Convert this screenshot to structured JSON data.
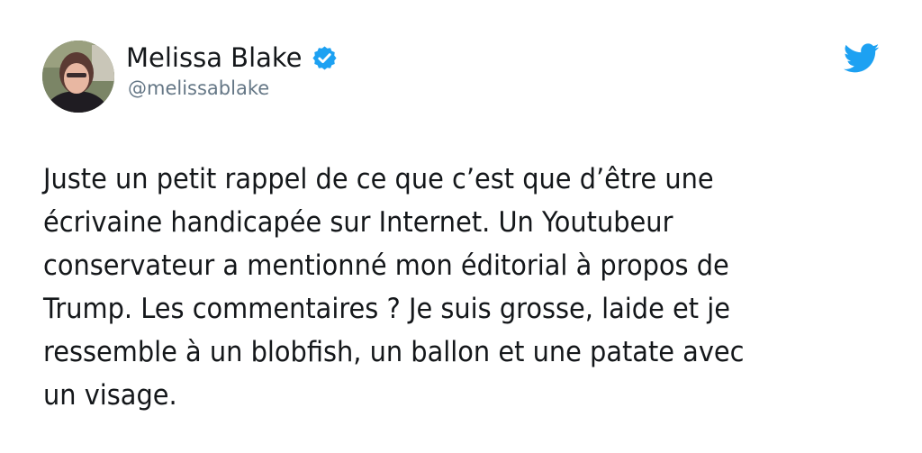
{
  "author": {
    "display_name": "Melissa Blake",
    "handle": "@melissablake",
    "verified": true,
    "avatar_icon": "avatar-photo"
  },
  "brand": {
    "icon": "twitter-bird-icon",
    "color": "#1da1f2"
  },
  "tweet": {
    "text": "Juste un petit rappel de ce que c’est que d’être une\nécrivaine handicapée sur Internet. Un Youtubeur\nconservateur a mentionné mon éditorial à propos de\nTrump. Les commentaires ? Je suis grosse, laide et je\nressemble à un blobfish, un ballon et une patate avec\nun visage."
  }
}
